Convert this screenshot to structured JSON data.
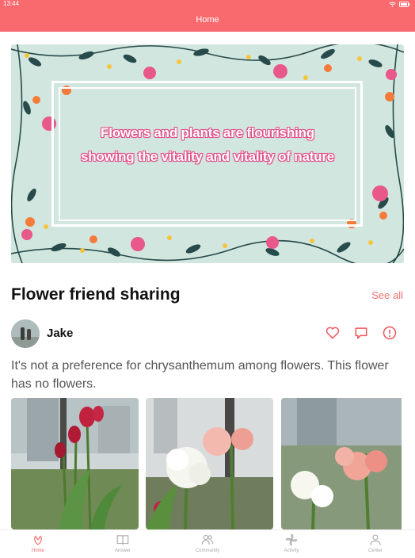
{
  "status_bar": {
    "time": "13:44"
  },
  "nav": {
    "title": "Home"
  },
  "banner": {
    "line1": "Flowers and plants are flourishing",
    "line2": "showing the vitality and vitality of nature"
  },
  "section": {
    "title": "Flower friend sharing",
    "see_all": "See all"
  },
  "post": {
    "author": "Jake",
    "text": "It's not a preference for chrysanthemum among flowers. This flower has no flowers.",
    "icons": [
      "heart-icon",
      "comment-icon",
      "report-icon"
    ],
    "photos": [
      "red-tulips-window-photo",
      "white-amaryllis-photo",
      "pink-amaryllis-photo"
    ]
  },
  "tabbar": {
    "items": [
      {
        "label": "Home",
        "icon": "flower-icon",
        "active": true
      },
      {
        "label": "Answer",
        "icon": "book-icon",
        "active": false
      },
      {
        "label": "Community",
        "icon": "people-icon",
        "active": false
      },
      {
        "label": "Activity",
        "icon": "pinwheel-icon",
        "active": false
      },
      {
        "label": "Center",
        "icon": "person-icon",
        "active": false
      }
    ]
  },
  "colors": {
    "accent": "#f96a6f",
    "link": "#f0726f",
    "banner_bg": "#d2e6e0",
    "banner_text_outline": "#e24e86"
  }
}
